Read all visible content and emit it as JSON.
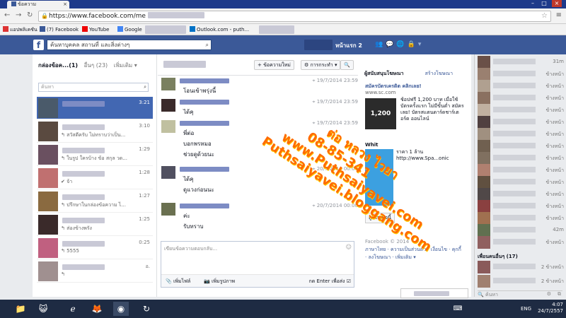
{
  "browser": {
    "tab_title": "ข้อความ",
    "url": "https://www.facebook.com/me",
    "bookmarks": [
      "แอปพลิเคชัน",
      "(7) Facebook",
      "YouTube",
      "Google",
      "Outlook.com - puth..."
    ]
  },
  "fb": {
    "search_placeholder": "ค้นหาบุคคล สถานที่ และสิ่งต่างๆ",
    "home_label": "หน้าแรก",
    "home_count": "2"
  },
  "inbox": {
    "title": "กล่องข้อค...(1)",
    "other": "อื่นๆ (23)",
    "more": "เพิ่มเติม ▾",
    "search_placeholder": "ค้นหา",
    "conversations": [
      {
        "time": "3:21",
        "preview": ""
      },
      {
        "time": "3:10",
        "preview": "↰ สวัสดีครับ ไม่ทราบว่าเป็น..."
      },
      {
        "time": "1:29",
        "preview": "↰ ในรูป ใครบ้าง ข้อ สกุล วด..."
      },
      {
        "time": "1:28",
        "preview": "✔ จ้า"
      },
      {
        "time": "1:27",
        "preview": "↰ ปรึกษาในกล่องข้อความ ไ..."
      },
      {
        "time": "1:25",
        "preview": "↰ ส่องข้างพรัง"
      },
      {
        "time": "0:25",
        "preview": "↰ 5555"
      },
      {
        "time": "อ.",
        "preview": "↰"
      }
    ]
  },
  "thread": {
    "new_message": "+ ข้อความใหม่",
    "actions": "⚙ การกระทำ ▾",
    "search_icon": "🔍",
    "messages": [
      {
        "date": "19/7/2014 23:59",
        "lines": [
          "โอนเข้าพรุ่งนี้"
        ]
      },
      {
        "date": "19/7/2014 23:59",
        "lines": [
          "ได้คุ"
        ]
      },
      {
        "date": "19/7/2014 23:59",
        "lines": [
          "พี่ต่อ",
          "บอกพรหมอ",
          "ช่วยดูด้วยนะ"
        ]
      },
      {
        "date": "20/7/2014 00:00",
        "lines": [
          "ได้คุ",
          "ดูแวงก่อนนะ"
        ]
      },
      {
        "date": "20/7/2014 00:00",
        "lines": [
          "ค่ะ",
          "รับทราบ"
        ]
      }
    ],
    "reply_placeholder": "เขียนข้อความตอบกลับ...",
    "add_file": "เพิ่มไฟล์",
    "add_photo": "เพิ่มรูปภาพ",
    "enter_to_send": "กด Enter เพื่อส่ง"
  },
  "rail": {
    "sponsored": "ผู้สนับสนุนโฆษณา",
    "create_ad": "สร้างโฆษณา",
    "ad1_title": "สมัครบัตรเครดิต คลิกเลย!",
    "ad1_url": "www.sc.com",
    "ad1_image_text": "1,200",
    "ad1_body": "ช้อปฟรี 1,200 บาท เมื่อใช้บัตรครั้งแรก ไม่มีขั้นต่ำ สมัครเลย! บัตรสแตนดาร์ดชาร์เตอร์ด ออนไลน์",
    "ad2_title": "Whit",
    "ad2_body": "ราคา 1 ล้าน http://www.Spa...onic",
    "like_page": "ถูกใจเพจนี้",
    "copyright": "Facebook © 2014",
    "footer_links": "ภาษาไทย · ความเป็นส่วนตัว · เงื่อนไข · คุกกี้ · ลงโฆษณา · เพิ่มเติม ▾"
  },
  "watermark": {
    "lines": [
      "ต่อ หลวง ไวยา",
      "08-85-341",
      "www.Puthsaiyavei.com",
      "Puthsaiyavei.bloggang.com"
    ]
  },
  "chat": {
    "statuses": [
      "31m",
      "ข้างหน้า",
      "ข้างหน้า",
      "ข้างหน้า",
      "ข้างหน้า",
      "ข้างหน้า",
      "ข้างหน้า",
      "ข้างหน้า",
      "ข้างหน้า",
      "ข้างหน้า",
      "ข้างหน้า",
      "ข้างหน้า",
      "ข้างหน้า",
      "ข้างหน้า",
      "42m",
      "ข้างหน้า"
    ],
    "group_header": "เพื่อนคนอื่นๆ (17)",
    "group_statuses": [
      "2 ข้างหน้า",
      "2 ข้างหน้า"
    ],
    "search_placeholder": "ค้นหา"
  },
  "taskbar": {
    "time": "4:07",
    "date": "24/7/2557",
    "lang": "ENG"
  },
  "colors": {
    "fb_blue": "#3b5998",
    "selected": "#4267b2",
    "watermark": "#ff6b00"
  }
}
